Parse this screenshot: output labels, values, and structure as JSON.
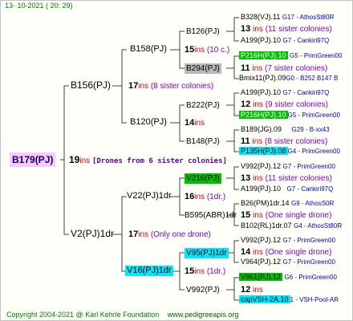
{
  "header": "13- 10-2021 ( 20: 29)",
  "footer": {
    "copyright": "Copyright 2004-2021 @ Karl Kehrle Foundation",
    "url": "www.pedigreeapis.org"
  },
  "root": {
    "name": "B179(PJ)",
    "count": "19",
    "ins": "ins",
    "note": "[Drones from 6 sister colonies]"
  },
  "gen1": [
    {
      "name": "B156(PJ)",
      "count": "17",
      "ins": "ins",
      "note": "(8 sister colonies)"
    },
    {
      "name": "V2(PJ)1dr",
      "count": "17",
      "ins": "ins",
      "note": "(Only one drone)"
    }
  ],
  "gen2": [
    {
      "name": "B158(PJ)",
      "count": "15",
      "ins": "ins",
      "note": "(10 c.)"
    },
    {
      "name": "B120(PJ)",
      "count": "14",
      "ins": "ins",
      "note": ""
    },
    {
      "name": "V22(PJ)1dr",
      "count": "16",
      "ins": "ins",
      "note": "(1dr.)"
    },
    {
      "name": "V16(PJ)1dr",
      "count": "15",
      "ins": "ins",
      "note": "(1dr.)"
    }
  ],
  "gen3": [
    {
      "name": "B126(PJ)",
      "count": "",
      "ins": "",
      "note": ""
    },
    {
      "name": "B294(PJ)",
      "count": "",
      "ins": "",
      "note": ""
    },
    {
      "name": "B222(PJ)",
      "count": "",
      "ins": "",
      "note": ""
    },
    {
      "name": "B148(PJ)",
      "count": "",
      "ins": "",
      "note": ""
    },
    {
      "name": "V216(PJ)",
      "count": "",
      "ins": "",
      "note": ""
    },
    {
      "name": "B595(ABR)1dr",
      "count": "",
      "ins": "",
      "note": ""
    },
    {
      "name": "V95(PJ)1dr",
      "count": "",
      "ins": "",
      "note": ""
    },
    {
      "name": "V992(PJ)",
      "count": "",
      "ins": "",
      "note": ""
    }
  ],
  "gen4": [
    {
      "name": "B328(VJ).11",
      "info": "G17 - AthosSt80R",
      "count": "13",
      "ins": "ins",
      "note": "(11 sister colonies)"
    },
    {
      "name": "A199(PJ).10",
      "info": "G7 - Cankiri97Q"
    },
    {
      "name": "P216H(PJ).10",
      "info": "G5 - PrimGreen00",
      "count": "11",
      "ins": "ins",
      "note": "(7 sister colonies)"
    },
    {
      "name": "Bmix11(PJ).09",
      "info": "G0 - B252 B147 B"
    },
    {
      "name": "A199(PJ).10",
      "info": "G7 - Cankiri97Q",
      "count": "12",
      "ins": "ins",
      "note": "(9 sister colonies)"
    },
    {
      "name": "P216H(PJ).10",
      "info": "G5 - PrimGreen00"
    },
    {
      "name": "B189(JG).09",
      "info": "G29 - B-xx43",
      "count": "11",
      "ins": "ins",
      "note": "(8 sister colonies)"
    },
    {
      "name": "P135H(PJ).08",
      "info": "G4 - PrimGreen00"
    },
    {
      "name": "V992(PJ).12",
      "info": "G7 - PrimGreen00",
      "count": "13",
      "ins": "ins",
      "note": "(11 sister colonies)"
    },
    {
      "name": "A199(PJ).10",
      "info": "G7 - Cankiri97Q"
    },
    {
      "name": "B26(PM)1dr.14",
      "info": "G9 - AthosS0R",
      "count": "15",
      "ins": "ins",
      "note": "(One single drone)"
    },
    {
      "name": "B102(RL)1dr.07",
      "info": "G4 - AthosSt80R"
    },
    {
      "name": "V992(PJ).12",
      "info": "G7 - PrimGreen00",
      "count": "14",
      "ins": "ins",
      "note": "(One single drone)"
    },
    {
      "name": "V964(PJ).12",
      "info": "G7 - PrimGreen00"
    },
    {
      "name": "V961(PJ).12",
      "info": "G6 - PrimGreen00",
      "count": "12",
      "ins": "ins",
      "note": ""
    },
    {
      "name": "capVSH-2A.10",
      "info": "1 - VSH-Pool-AR"
    }
  ]
}
